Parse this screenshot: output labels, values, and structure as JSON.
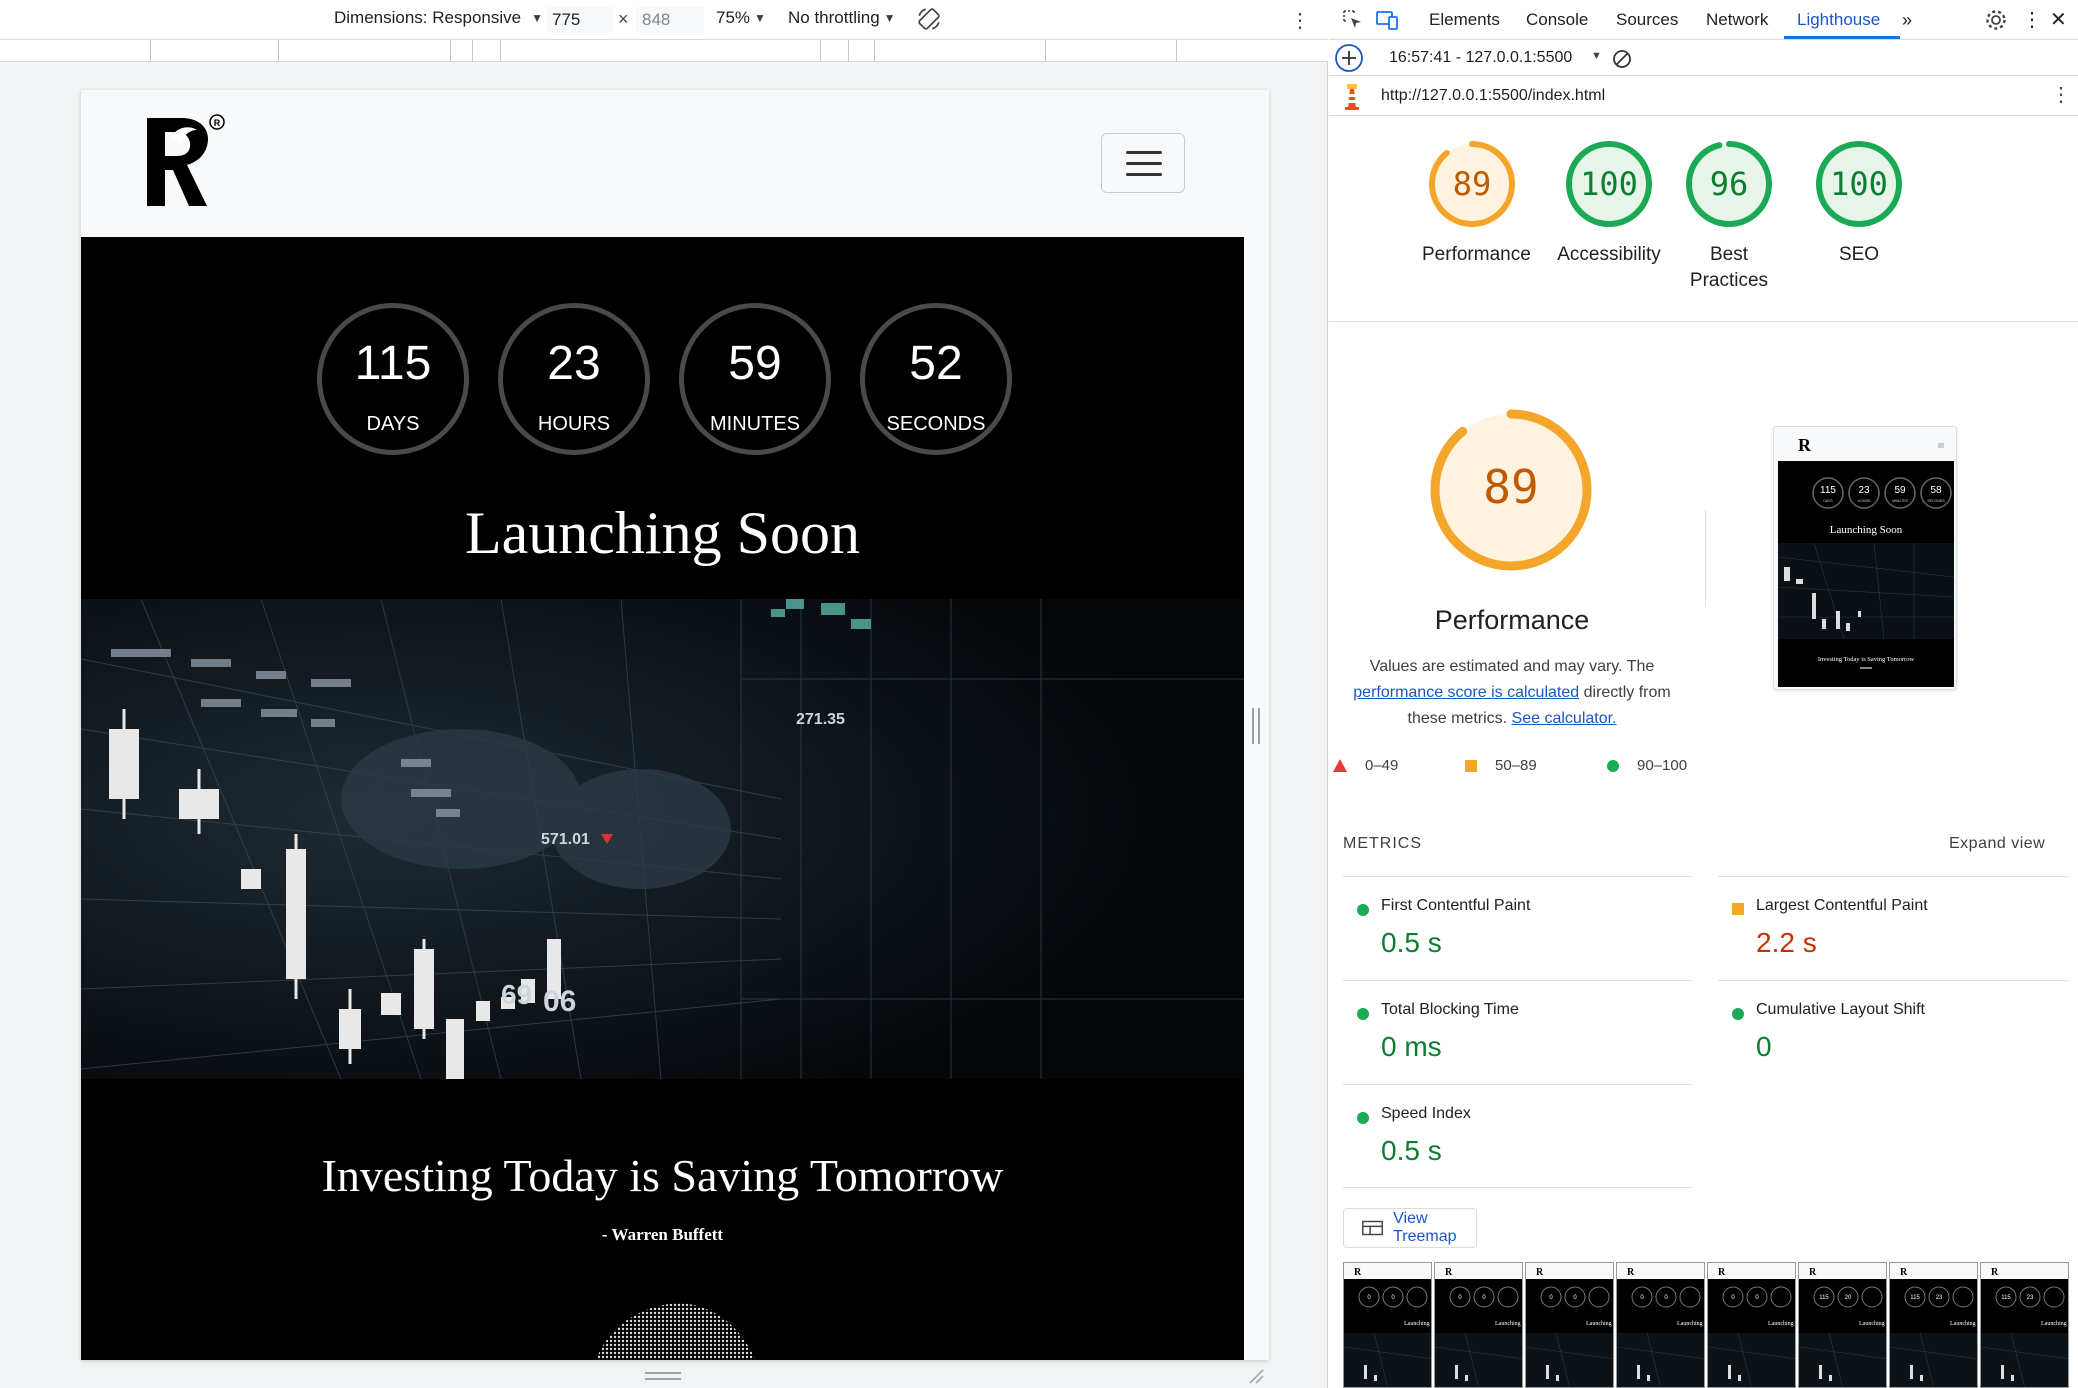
{
  "emulation_toolbar": {
    "dimensions_label": "Dimensions: Responsive",
    "width_value": "775",
    "height_value": "848",
    "zoom": "75%",
    "throttling": "No throttling",
    "x_sep": "×"
  },
  "site": {
    "countdown": [
      {
        "value": "115",
        "label": "DAYS"
      },
      {
        "value": "23",
        "label": "HOURS"
      },
      {
        "value": "59",
        "label": "MINUTES"
      },
      {
        "value": "52",
        "label": "SECONDS"
      }
    ],
    "headline": "Launching Soon",
    "market_labels": [
      "271.35",
      "571.01",
      "69",
      "06"
    ],
    "quote": "Investing Today is Saving Tomorrow",
    "author": "- Warren Buffett"
  },
  "devtools": {
    "tabs": [
      "Elements",
      "Console",
      "Sources",
      "Network",
      "Lighthouse"
    ],
    "active_tab": "Lighthouse",
    "report_time": "16:57:41 - 127.0.0.1:5500",
    "url": "http://127.0.0.1:5500/index.html",
    "scores": [
      {
        "value": "89",
        "label": "Performance",
        "color": "#e67700",
        "fill": "#fff3e0"
      },
      {
        "value": "100",
        "label": "Accessibility",
        "color": "#0c7e32",
        "fill": "#e6f4ea"
      },
      {
        "value": "96",
        "label": "Best Practices",
        "color": "#0c7e32",
        "fill": "#e6f4ea"
      },
      {
        "value": "100",
        "label": "SEO",
        "color": "#0c7e32",
        "fill": "#e6f4ea"
      }
    ],
    "performance": {
      "score": "89",
      "title": "Performance",
      "desc_1": "Values are estimated and may vary. The",
      "desc_link_1": "performance score is calculated",
      "desc_2": "directly from",
      "desc_3": "these metrics.",
      "desc_link_2": "See calculator."
    },
    "legend": [
      {
        "range": "0–49",
        "shape": "triangle",
        "color": "#e53935"
      },
      {
        "range": "50–89",
        "shape": "square",
        "color": "#f4a62a"
      },
      {
        "range": "90–100",
        "shape": "circle",
        "color": "#1aaa55"
      }
    ],
    "thumb": {
      "timers": [
        "115",
        "23",
        "59",
        "58"
      ],
      "timer_labels": [
        "DAYS",
        "HOURS",
        "MINUTES",
        "SECONDS"
      ],
      "headline": "Launching Soon",
      "quote": "Investing Today is Saving Tomorrow"
    },
    "metrics_heading": "METRICS",
    "expand_label": "Expand view",
    "metrics": [
      {
        "name": "First Contentful Paint",
        "value": "0.5 s",
        "status": "pass",
        "color": "#0c7e32"
      },
      {
        "name": "Largest Contentful Paint",
        "value": "2.2 s",
        "status": "average",
        "color": "#c33300"
      },
      {
        "name": "Total Blocking Time",
        "value": "0 ms",
        "status": "pass",
        "color": "#0c7e32"
      },
      {
        "name": "Cumulative Layout Shift",
        "value": "0",
        "status": "pass",
        "color": "#0c7e32"
      },
      {
        "name": "Speed Index",
        "value": "0.5 s",
        "status": "pass",
        "color": "#0c7e32"
      }
    ],
    "treemap_label": "View Treemap",
    "filmstrip": [
      {
        "t1": "0",
        "t2": "0"
      },
      {
        "t1": "0",
        "t2": "0"
      },
      {
        "t1": "0",
        "t2": "0"
      },
      {
        "t1": "0",
        "t2": "0"
      },
      {
        "t1": "0",
        "t2": "0"
      },
      {
        "t1": "115",
        "t2": "20"
      },
      {
        "t1": "115",
        "t2": "23"
      },
      {
        "t1": "115",
        "t2": "23"
      }
    ],
    "filmstrip_caption": "Launching"
  }
}
